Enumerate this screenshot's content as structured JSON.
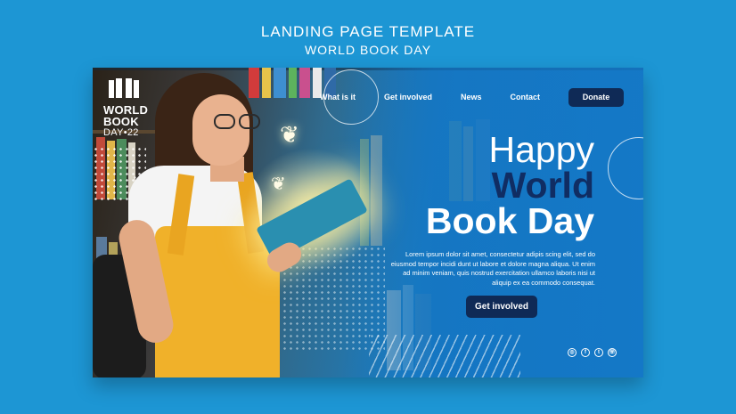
{
  "page": {
    "title_line1": "LANDING PAGE TEMPLATE",
    "title_line2": "WORLD BOOK DAY"
  },
  "logo": {
    "line1": "WORLD",
    "line2": "BOOK",
    "line3": "DAY•22",
    "icon": "open-book-icon"
  },
  "nav": {
    "items": [
      {
        "label": "What is it"
      },
      {
        "label": "Get involved"
      },
      {
        "label": "News"
      },
      {
        "label": "Contact"
      }
    ],
    "donate_label": "Donate"
  },
  "hero": {
    "line1": "Happy",
    "line2": "World",
    "line3": "Book Day",
    "description": "Lorem ipsum dolor sit amet, consectetur adipis scing elit, sed do eiusmod tempor incidi dunt ut labore et dolore magna aliqua. Ut enim ad minim veniam, quis nostrud exercitation ullamco laboris nisi ut aliquip ex ea commodo consequat.",
    "cta_label": "Get involved"
  },
  "social": {
    "icons": [
      "instagram-icon",
      "facebook-icon",
      "twitter-icon",
      "whatsapp-icon"
    ]
  },
  "colors": {
    "background": "#1d96d4",
    "navy": "#0f2a56",
    "accent_yellow": "#f0b12a"
  }
}
